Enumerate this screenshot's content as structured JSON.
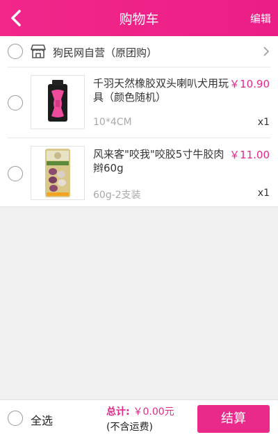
{
  "header": {
    "title": "购物车",
    "edit_label": "编辑",
    "back_icon": "chevron-left-icon"
  },
  "shop": {
    "name": "狗民网自营（原团购）",
    "icon": "store-icon",
    "arrow_icon": "chevron-right-icon"
  },
  "items": [
    {
      "name": "千羽天然橡胶双头喇叭犬用玩具（颜色随机）",
      "price": "￥10.90",
      "spec": "10*4CM",
      "qty": "x1"
    },
    {
      "name": "风来客\"咬我\"咬胶5寸牛胶肉辫60g",
      "price": "￥11.00",
      "spec": "60g-2支装",
      "qty": "x1"
    }
  ],
  "footer": {
    "select_all": "全选",
    "total_label": "总计:",
    "total_value": "￥0.00元",
    "freight_note": "(不含运费)",
    "checkout_label": "结算"
  },
  "colors": {
    "accent": "#ea1e86",
    "price": "#e4288a"
  }
}
